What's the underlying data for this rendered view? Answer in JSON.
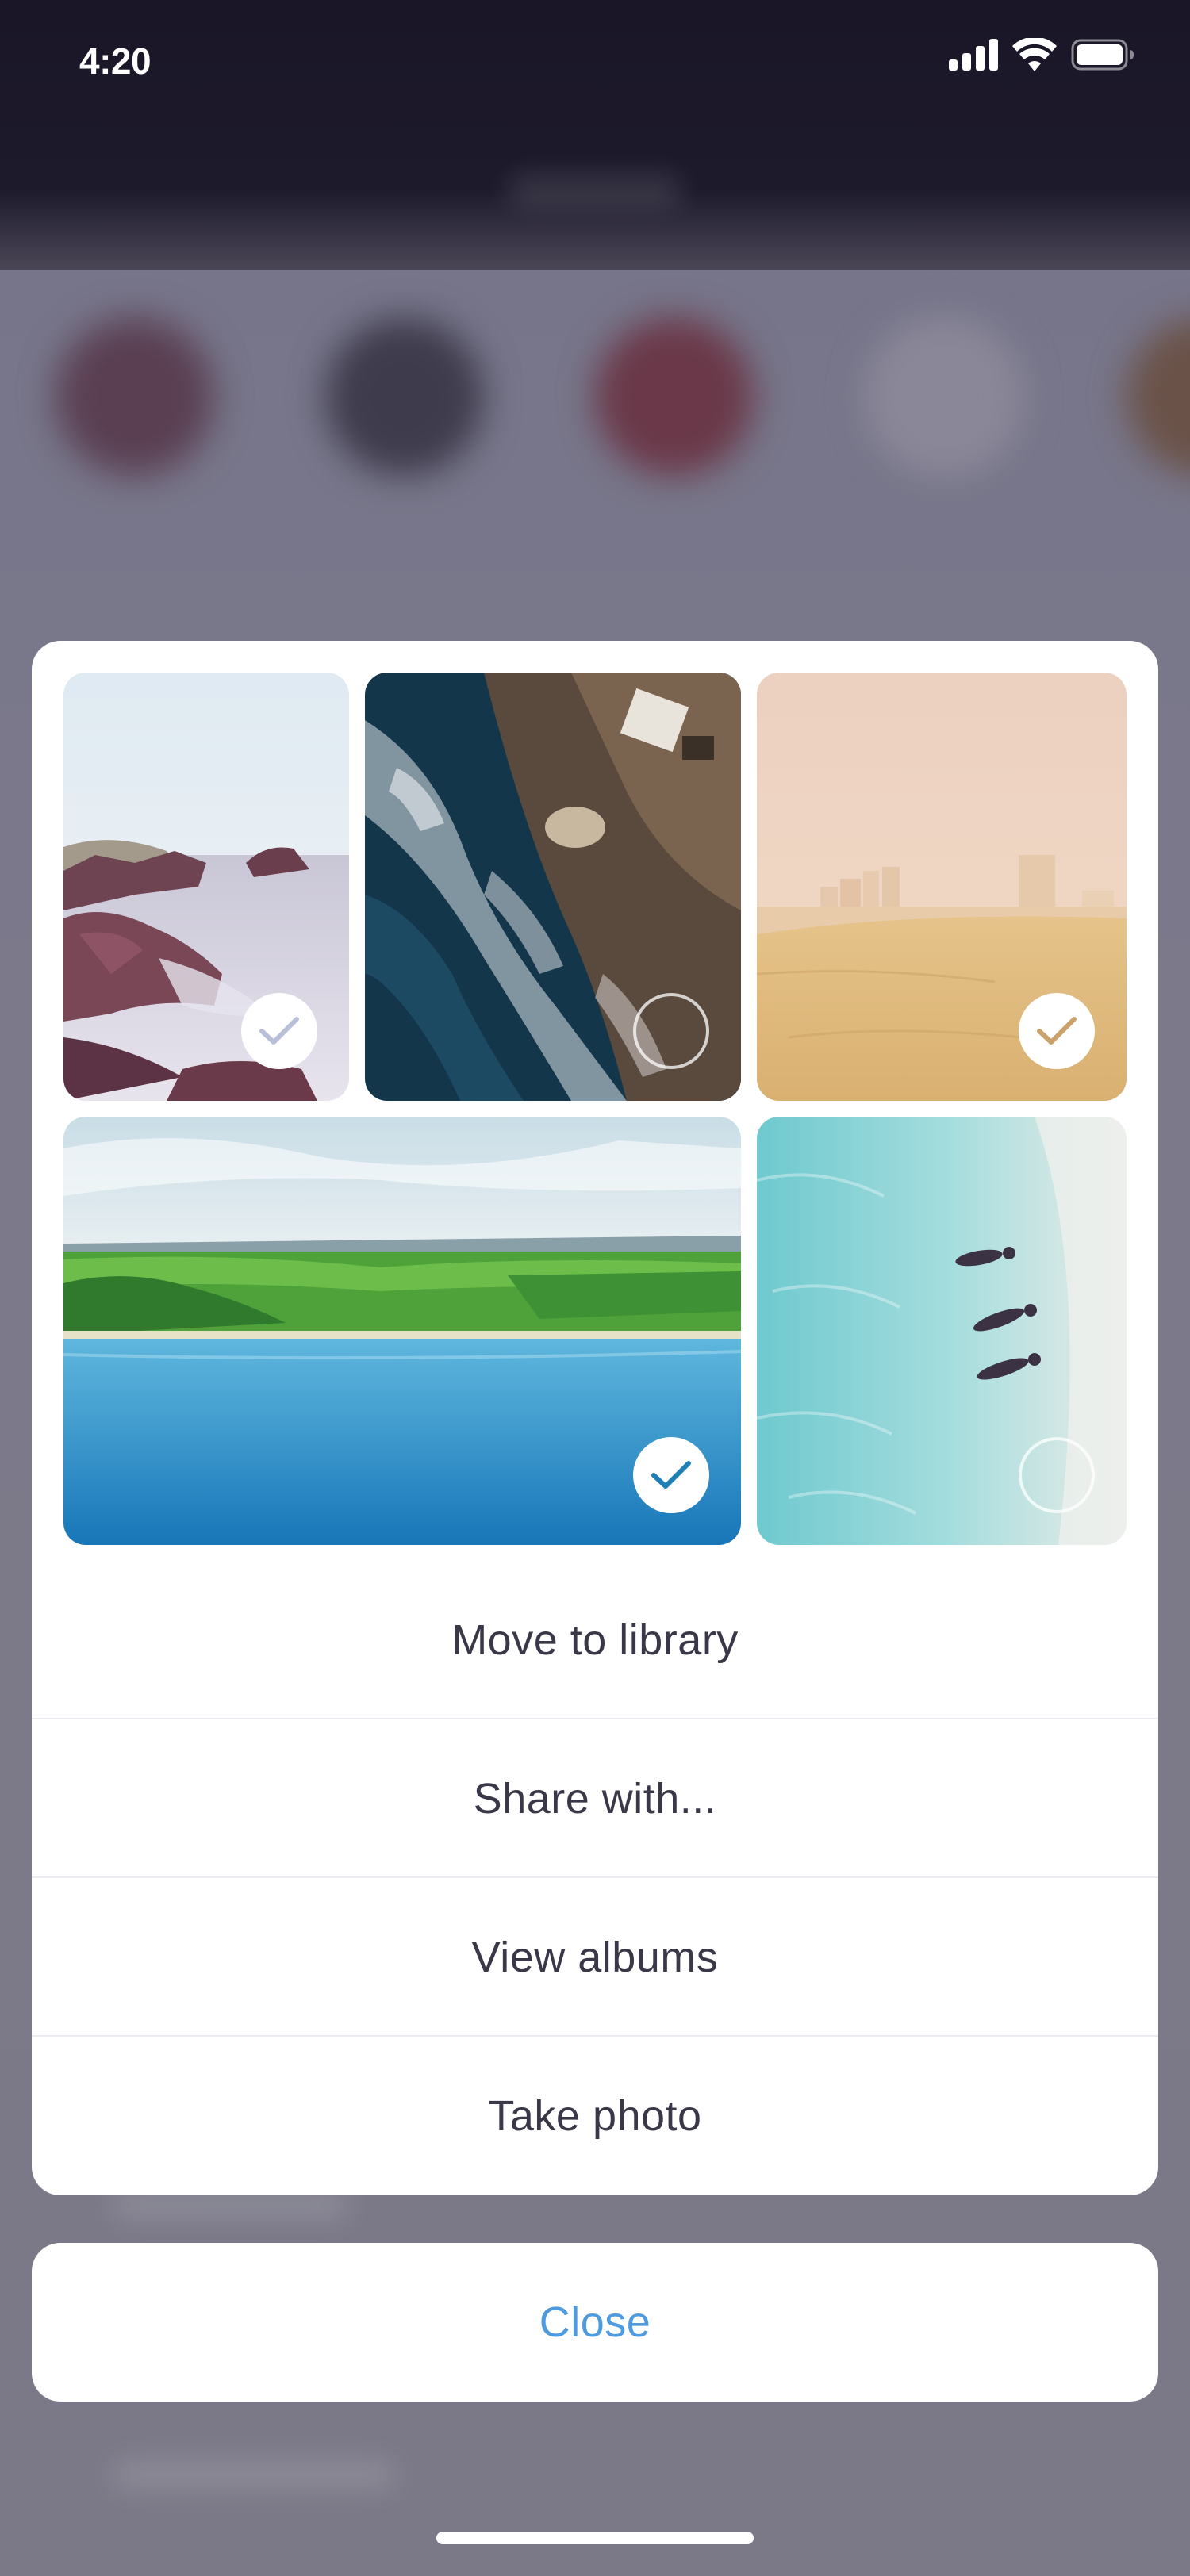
{
  "status_bar": {
    "time": "4:20",
    "icons": [
      "cellular-signal-icon",
      "wifi-icon",
      "battery-icon"
    ]
  },
  "photo_grid": {
    "photos": [
      {
        "name": "rocky-coast-photo",
        "selected": true,
        "check_color": "#b9bfd8"
      },
      {
        "name": "aerial-waves-photo",
        "selected": false,
        "check_color": "#ffffff"
      },
      {
        "name": "sandy-beach-city-photo",
        "selected": true,
        "check_color": "#c9a26c"
      },
      {
        "name": "green-coastline-photo",
        "selected": true,
        "check_color": "#1e7fb5"
      },
      {
        "name": "swimmers-aerial-photo",
        "selected": false,
        "check_color": "#ffffff"
      }
    ]
  },
  "actions": [
    {
      "label": "Move to library"
    },
    {
      "label": "Share with..."
    },
    {
      "label": "View albums"
    },
    {
      "label": "Take photo"
    }
  ],
  "close": {
    "label": "Close"
  },
  "colors": {
    "action_text": "#3a3848",
    "close_text": "#4f9be0",
    "sheet_bg": "#ffffff",
    "overlay_bg": "#7a7886"
  }
}
